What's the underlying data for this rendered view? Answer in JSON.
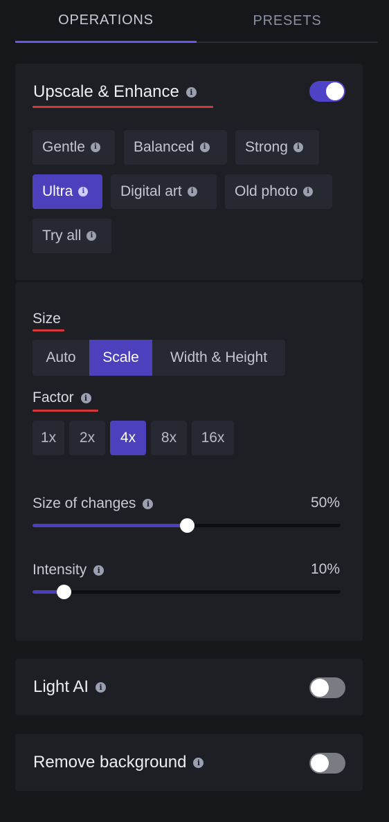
{
  "tabs": [
    {
      "label": "OPERATIONS",
      "active": true
    },
    {
      "label": "PRESETS",
      "active": false
    }
  ],
  "upscale": {
    "title": "Upscale & Enhance",
    "enabled": true,
    "modes": [
      "Gentle",
      "Balanced",
      "Strong",
      "Ultra",
      "Digital art",
      "Old photo",
      "Try all"
    ],
    "selected_mode": "Ultra"
  },
  "size": {
    "label": "Size",
    "options": [
      "Auto",
      "Scale",
      "Width & Height"
    ],
    "selected": "Scale"
  },
  "factor": {
    "label": "Factor",
    "options": [
      "1x",
      "2x",
      "4x",
      "8x",
      "16x"
    ],
    "selected": "4x"
  },
  "sliders": {
    "size_of_changes": {
      "label": "Size of changes",
      "value_text": "50%",
      "value": 0.5
    },
    "intensity": {
      "label": "Intensity",
      "value_text": "10%",
      "value": 0.1
    }
  },
  "light_ai": {
    "label": "Light AI",
    "enabled": false
  },
  "remove_background": {
    "label": "Remove background",
    "enabled": false
  },
  "icons": {
    "info": "info-icon"
  },
  "colors": {
    "accent": "#4c40bd",
    "underline": "#d7363b",
    "panel": "#1e1f24",
    "background": "#16171b"
  }
}
